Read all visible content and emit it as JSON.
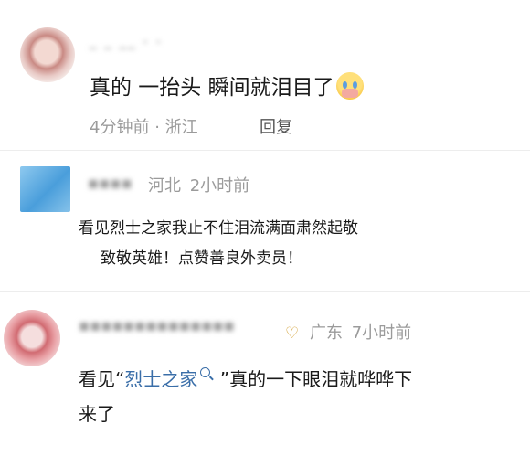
{
  "comments": [
    {
      "username": "_ _ __ - -",
      "text": "真的 一抬头 瞬间就泪目了",
      "emoji_icon": "crying-face-emoji",
      "time": "4分钟前",
      "separator": "·",
      "location": "浙江",
      "reply_label": "回复"
    },
    {
      "username": "▪▪▪▪",
      "location": "河北",
      "time": "2小时前",
      "text_line1": "看见烈士之家我止不住泪流满面肃然起敬",
      "text_line2": "致敬英雄！点赞善良外卖员！"
    },
    {
      "username": "▪▪▪▪▪▪▪▪▪▪▪▪▪▪",
      "badge_icon": "heart-badge-icon",
      "location": "广东",
      "time": "7小时前",
      "text_prefix": "看见“",
      "link_text": "烈士之家",
      "text_suffix": " ”真的一下眼泪就哗哗下",
      "text_line2": "来了"
    }
  ],
  "colors": {
    "link": "#3a6ea8",
    "meta_gray": "#9b9b9b",
    "text": "#1a1a1a"
  }
}
